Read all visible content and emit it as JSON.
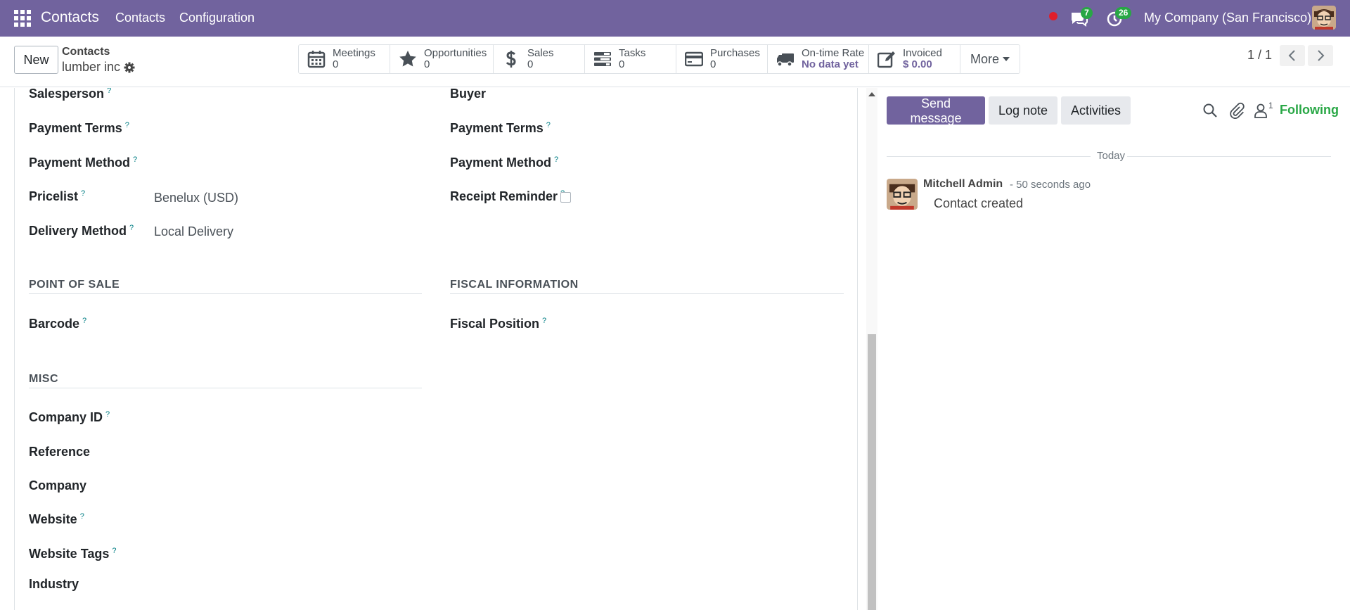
{
  "navbar": {
    "app_name": "Contacts",
    "menu": [
      "Contacts",
      "Configuration"
    ],
    "messages_count": "7",
    "activities_count": "26",
    "company": "My Company (San Francisco)"
  },
  "control": {
    "new_label": "New",
    "breadcrumb_parent": "Contacts",
    "breadcrumb_current": "lumber inc",
    "stats": [
      {
        "label": "Meetings",
        "value": "0",
        "icon": "calendar-icon"
      },
      {
        "label": "Opportunities",
        "value": "0",
        "icon": "star-icon"
      },
      {
        "label": "Sales",
        "value": "0",
        "icon": "dollar-icon"
      },
      {
        "label": "Tasks",
        "value": "0",
        "icon": "tasks-icon"
      },
      {
        "label": "Purchases",
        "value": "0",
        "icon": "credit-card-icon"
      },
      {
        "label": "On-time Rate",
        "value": "No data yet",
        "icon": "truck-icon"
      },
      {
        "label": "Invoiced",
        "value": "$ 0.00",
        "icon": "edit-icon"
      }
    ],
    "more_label": "More",
    "pager": "1 / 1"
  },
  "form": {
    "left": {
      "salesperson": "Salesperson",
      "payment_terms": "Payment Terms",
      "payment_method": "Payment Method",
      "pricelist": "Pricelist",
      "pricelist_value": "Benelux (USD)",
      "delivery_method": "Delivery Method",
      "delivery_method_value": "Local Delivery"
    },
    "right": {
      "buyer": "Buyer",
      "payment_terms": "Payment Terms",
      "payment_method": "Payment Method",
      "receipt_reminder": "Receipt Reminder"
    },
    "pos_title": "POINT OF SALE",
    "barcode": "Barcode",
    "fiscal_title": "FISCAL INFORMATION",
    "fiscal_position": "Fiscal Position",
    "misc_title": "MISC",
    "company_id": "Company ID",
    "reference": "Reference",
    "company": "Company",
    "website": "Website",
    "website_tags": "Website Tags",
    "industry": "Industry",
    "help_mark": "?"
  },
  "chatter": {
    "send_message": "Send message",
    "log_note": "Log note",
    "activities": "Activities",
    "followers_count": "1",
    "following": "Following",
    "today": "Today",
    "message": {
      "author": "Mitchell Admin",
      "time": "- 50 seconds ago",
      "body": "Contact created"
    }
  },
  "colors": {
    "brand": "#71639e",
    "success": "#28a745",
    "help": "#017e84"
  }
}
